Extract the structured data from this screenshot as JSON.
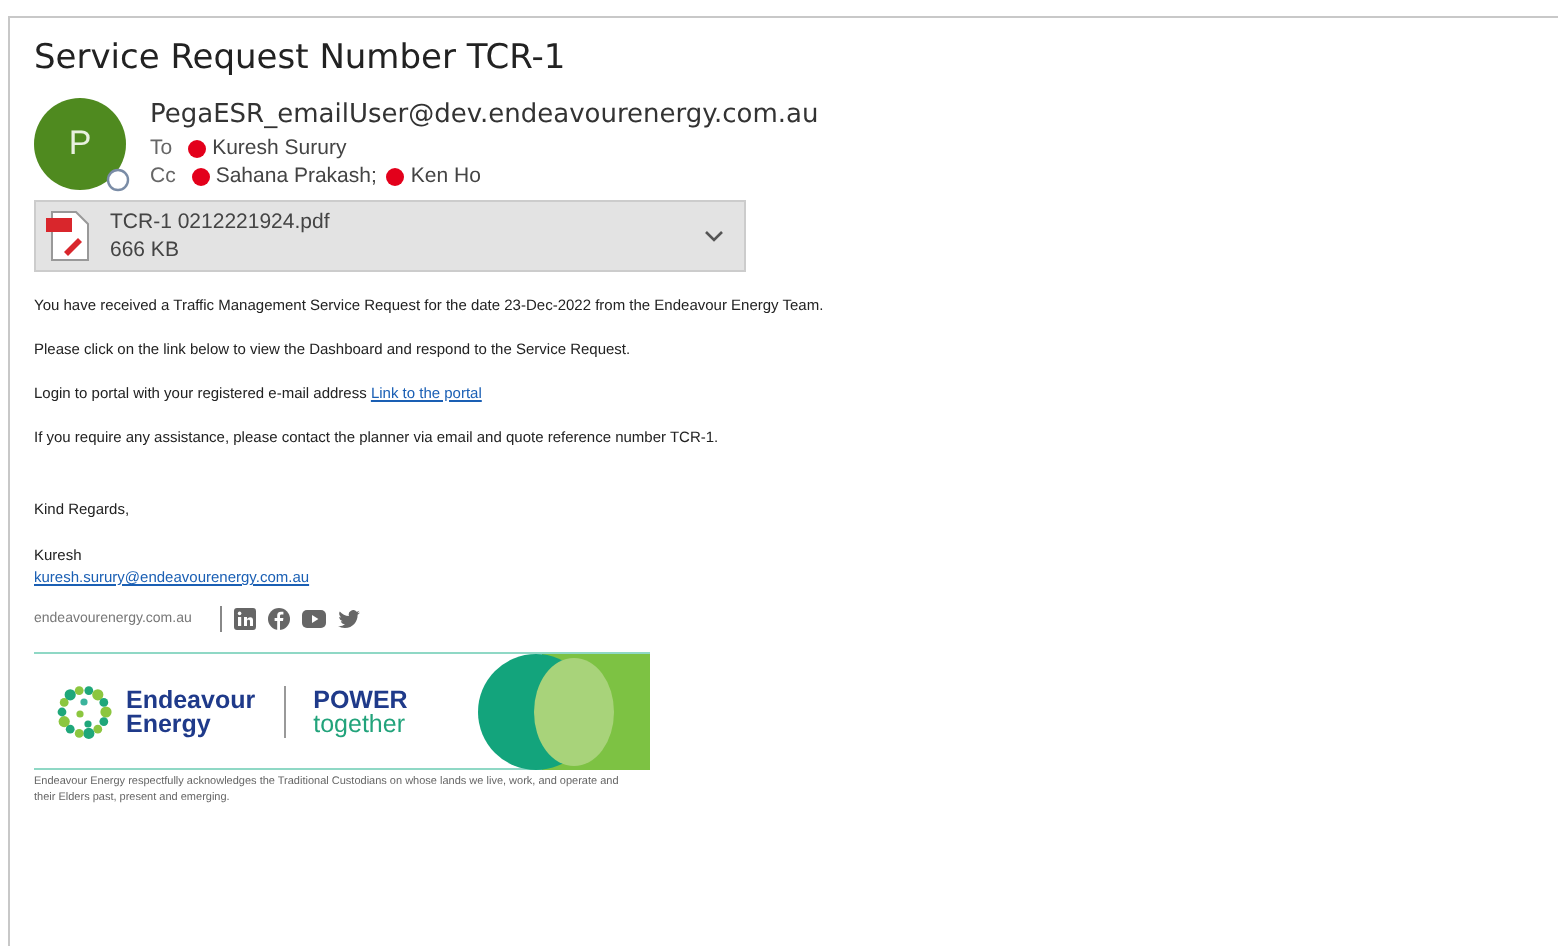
{
  "subject": "Service Request Number TCR-1",
  "sender": {
    "initial": "P",
    "address": "PegaESR_emailUser@dev.endeavourenergy.com.au"
  },
  "to": {
    "label": "To",
    "recipients": [
      "Kuresh Surury"
    ]
  },
  "cc": {
    "label": "Cc",
    "recipients": [
      "Sahana Prakash;",
      "Ken Ho"
    ]
  },
  "attachment": {
    "name": "TCR-1 0212221924.pdf",
    "size": "666 KB"
  },
  "body": [
    {
      "text": "You have received a Traffic Management Service Request for the date 23-Dec-2022 from the Endeavour Energy Team."
    },
    {
      "text": "Please click on the link below to view the Dashboard and respond to the Service Request."
    },
    {
      "text": "Login to portal with your registered e-mail address",
      "link": "Link to the portal"
    },
    {
      "text": "If you require any assistance, please contact the planner via email and quote reference number TCR-1."
    }
  ],
  "signature": {
    "closing": "Kind Regards,",
    "name": "Kuresh",
    "email": "kuresh.surury@endeavourenergy.com.au",
    "website": "endeavourenergy.com.au"
  },
  "banner": {
    "brand_line_1": "Endeavour",
    "brand_line_2": "Energy",
    "slogan_line_1": "POWER",
    "slogan_line_2": "together"
  },
  "acknowledgement": "Endeavour Energy respectfully acknowledges the Traditional Custodians on whose lands we live, work, and operate and their Elders past, present and emerging."
}
